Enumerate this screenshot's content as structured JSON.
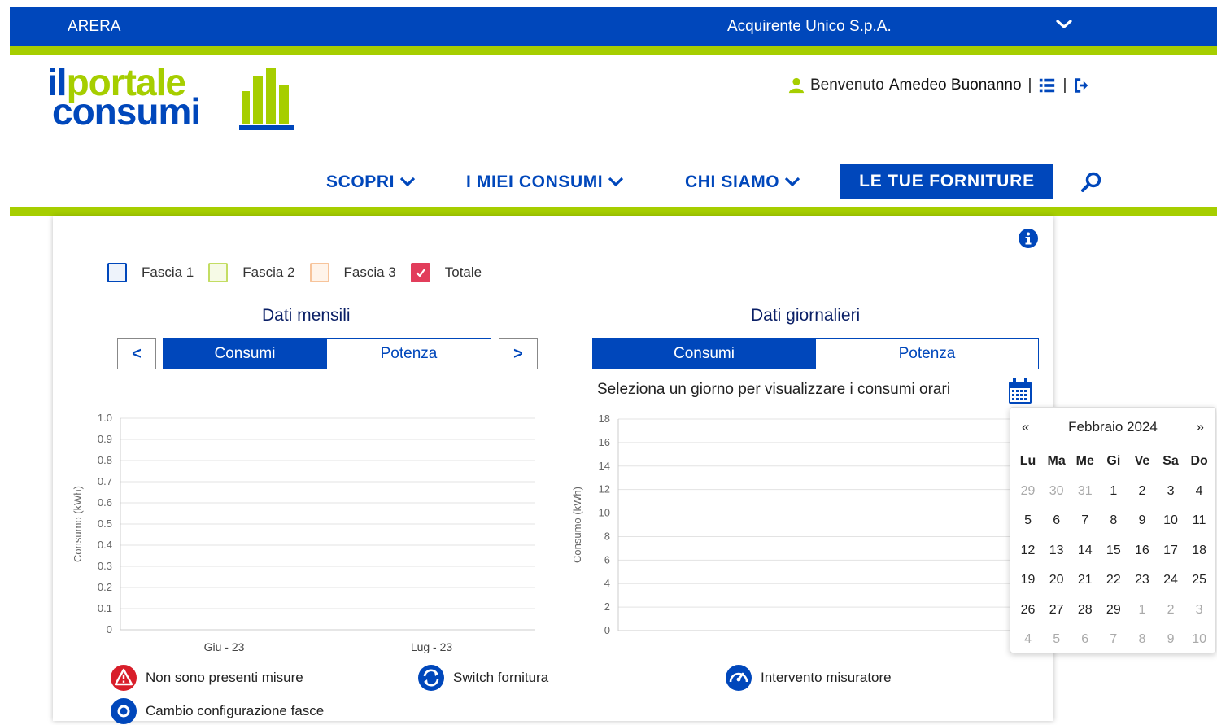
{
  "topbar": {
    "left": "ARERA",
    "center": "Acquirente Unico S.p.A."
  },
  "logo": {
    "line1a": "il",
    "line1b": "portale",
    "line2": "consumi"
  },
  "header": {
    "welcome": "Benvenuto",
    "user_name": "Amedeo Buonanno"
  },
  "nav": {
    "items": [
      "SCOPRI",
      "I MIEI CONSUMI",
      "CHI SIAMO"
    ],
    "cta": "LE TUE FORNITURE"
  },
  "legend": [
    {
      "label": "Fascia 1",
      "color": "#0047bb",
      "checked": false
    },
    {
      "label": "Fascia 2",
      "color": "#a6ce00",
      "checked": false
    },
    {
      "label": "Fascia 3",
      "color": "#f5a65b",
      "checked": false
    },
    {
      "label": "Totale",
      "color": "#e23d5b",
      "checked": true
    }
  ],
  "monthly": {
    "title": "Dati mensili",
    "tab_active": "Consumi",
    "tab_other": "Potenza",
    "prev": "<",
    "next": ">"
  },
  "daily": {
    "title": "Dati giornalieri",
    "tab_active": "Consumi",
    "tab_other": "Potenza",
    "hint": "Seleziona un giorno per visualizzare i consumi orari"
  },
  "chart_data": [
    {
      "type": "bar",
      "ylabel": "Consumo (kWh)",
      "categories": [
        "Giu - 23",
        "Lug - 23"
      ],
      "ylim": [
        0,
        1.0
      ],
      "yticks": [
        "1.0",
        "0.9",
        "0.8",
        "0.7",
        "0.6",
        "0.5",
        "0.4",
        "0.3",
        "0.2",
        "0.1",
        "0"
      ],
      "values": []
    },
    {
      "type": "bar",
      "ylabel": "Consumo (kWh)",
      "categories": [],
      "ylim": [
        0,
        18
      ],
      "yticks": [
        "18",
        "16",
        "14",
        "12",
        "10",
        "8",
        "6",
        "4",
        "2",
        "0"
      ],
      "values": []
    }
  ],
  "datepicker": {
    "prev": "«",
    "next": "»",
    "title": "Febbraio 2024",
    "dow": [
      "Lu",
      "Ma",
      "Me",
      "Gi",
      "Ve",
      "Sa",
      "Do"
    ],
    "weeks": [
      [
        "29",
        "30",
        "31",
        "1",
        "2",
        "3",
        "4"
      ],
      [
        "5",
        "6",
        "7",
        "8",
        "9",
        "10",
        "11"
      ],
      [
        "12",
        "13",
        "14",
        "15",
        "16",
        "17",
        "18"
      ],
      [
        "19",
        "20",
        "21",
        "22",
        "23",
        "24",
        "25"
      ],
      [
        "26",
        "27",
        "28",
        "29",
        "1",
        "2",
        "3"
      ],
      [
        "4",
        "5",
        "6",
        "7",
        "8",
        "9",
        "10"
      ]
    ]
  },
  "markers": {
    "no_measure": "Non sono presenti misure",
    "switch": "Switch fornitura",
    "intervento": "Intervento misuratore",
    "cambio": "Cambio configurazione fasce"
  }
}
